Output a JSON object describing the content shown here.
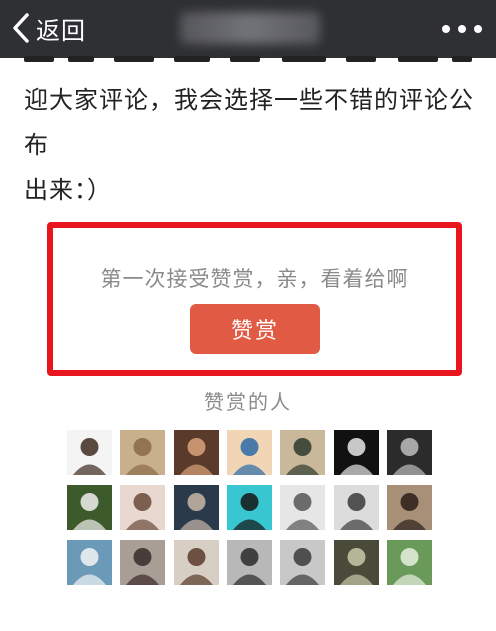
{
  "nav": {
    "back_label": "返回",
    "back_icon": "chevron-left-icon",
    "more_icon": "ellipsis-icon"
  },
  "article": {
    "line1": "迎大家评论，我会选择一些不错的评论公布",
    "line2": "出来：）"
  },
  "reward": {
    "prompt": "第一次接受赞赏，亲，看着给啊",
    "button_label": "赞赏",
    "highlight_color": "#e8151e",
    "button_color": "#e05a44"
  },
  "rewarders": {
    "title": "赞赏的人",
    "avatars": [
      {
        "bg": "#f4f4f4",
        "fg": "#3d2a1e"
      },
      {
        "bg": "#c9b08c",
        "fg": "#8a6a48"
      },
      {
        "bg": "#5a3a2a",
        "fg": "#d9a37a"
      },
      {
        "bg": "#f1d6b5",
        "fg": "#2b6aa8"
      },
      {
        "bg": "#c9b89a",
        "fg": "#2f3a2f"
      },
      {
        "bg": "#111111",
        "fg": "#e8e8e8"
      },
      {
        "bg": "#2b2b2b",
        "fg": "#bdbdbd"
      },
      {
        "bg": "#3d5a2a",
        "fg": "#f0f0f0"
      },
      {
        "bg": "#e8d8d0",
        "fg": "#6a4a3a"
      },
      {
        "bg": "#2a3a4a",
        "fg": "#c9b8a8"
      },
      {
        "bg": "#38c7d0",
        "fg": "#141414"
      },
      {
        "bg": "#e6e6e6",
        "fg": "#555555"
      },
      {
        "bg": "#dcdcdc",
        "fg": "#3a3a3a"
      },
      {
        "bg": "#a89078",
        "fg": "#2a1f18"
      },
      {
        "bg": "#6a9ab8",
        "fg": "#f4f4f4"
      },
      {
        "bg": "#a89e96",
        "fg": "#3a2a2a"
      },
      {
        "bg": "#d8cfc4",
        "fg": "#5a3a2a"
      },
      {
        "bg": "#b8b8b8",
        "fg": "#2a2a2a"
      },
      {
        "bg": "#c8c8c8",
        "fg": "#3a3a3a"
      },
      {
        "bg": "#4a4a3a",
        "fg": "#c8c8a8"
      },
      {
        "bg": "#6a9a5a",
        "fg": "#e8f0e0"
      }
    ]
  }
}
